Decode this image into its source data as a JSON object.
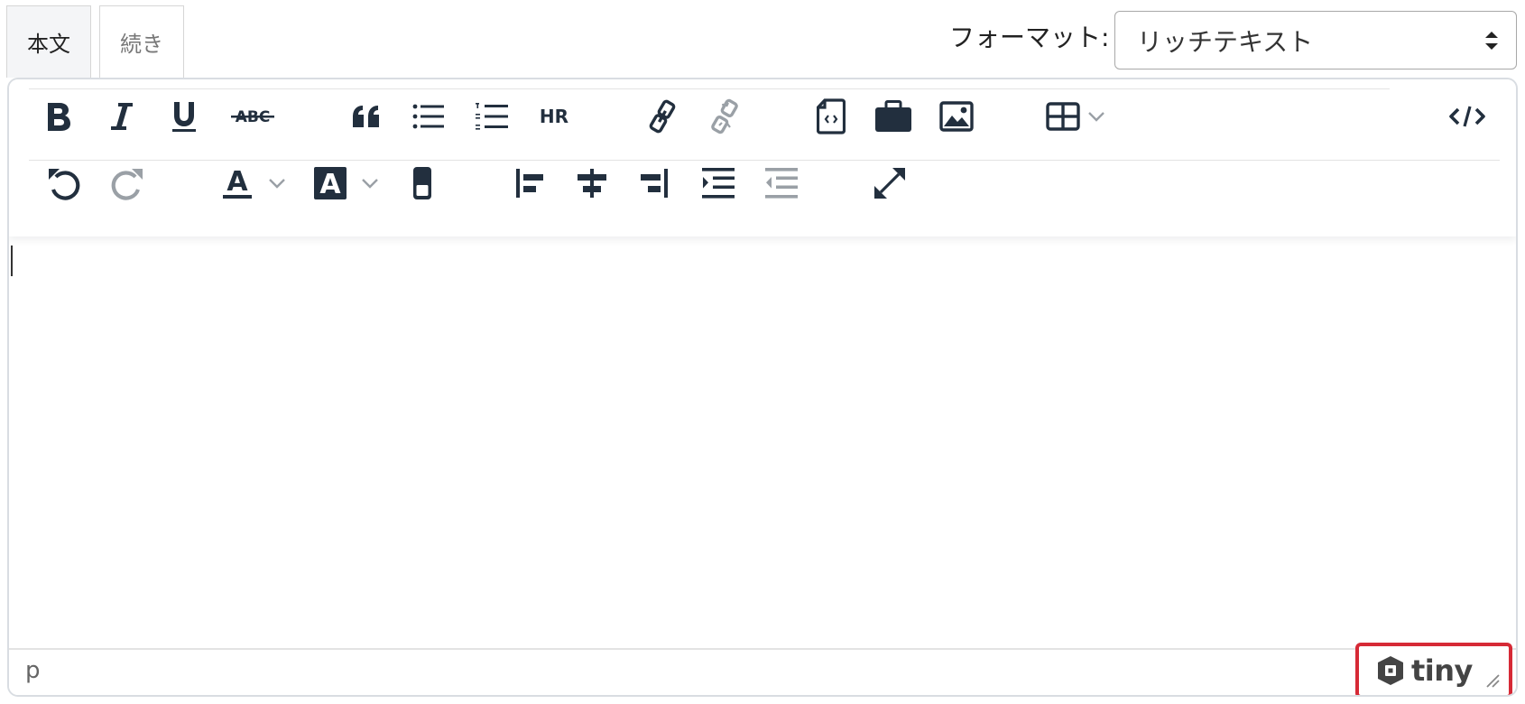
{
  "tabs": [
    {
      "label": "本文",
      "active": true
    },
    {
      "label": "続き",
      "active": false
    }
  ],
  "format": {
    "label": "フォーマット:",
    "selected": "リッチテキスト"
  },
  "toolbar": {
    "row1": [
      "bold-icon",
      "italic-icon",
      "underline-icon",
      "strikethrough-icon",
      "blockquote-icon",
      "bullet-list-icon",
      "numbered-list-icon",
      "horizontal-rule-icon",
      "link-icon",
      "unlink-icon",
      "template-icon",
      "briefcase-icon",
      "image-icon",
      "table-icon",
      "source-code-icon"
    ],
    "row2": [
      "undo-icon",
      "redo-icon",
      "text-color-icon",
      "background-color-icon",
      "remove-format-icon",
      "align-left-icon",
      "align-center-icon",
      "align-right-icon",
      "indent-icon",
      "outdent-icon",
      "fullscreen-icon"
    ],
    "hr_label": "HR",
    "strike_label": "ABC",
    "text_color_glyph": "A",
    "bg_color_glyph": "A"
  },
  "statusbar": {
    "path": "p",
    "brand": "tiny"
  },
  "colors": {
    "icon": "#222f3e",
    "icon_disabled": "#9aa0a6",
    "brand_highlight": "#d62a36",
    "border": "#d9dde2"
  }
}
